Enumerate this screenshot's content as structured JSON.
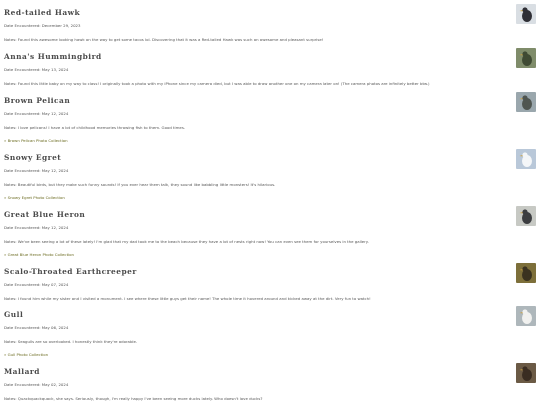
{
  "entries": [
    {
      "name": "Red-tailed Hawk",
      "date": "Date Encountered: December 29, 2023",
      "notes": "Notes: Found this awesome looking hawk on the way to get some tacos lol. Discovering that it was a Red-tailed Hawk was such an awesome and pleasant surprise!",
      "link": "",
      "thumb_icon": "hawk-photo",
      "thumb_colors": [
        "#d9dee3",
        "#2f2f35"
      ]
    },
    {
      "name": "Anna's Hummingbird",
      "date": "Date Encountered: May 13, 2024",
      "notes": "Notes: Found this little baby on my way to class! I originally took a photo with my iPhone since my camera died, but I was able to draw another one on my camera later on! (The camera photos are infinitely better btw.)",
      "link": "",
      "thumb_icon": "hummingbird-photo",
      "thumb_colors": [
        "#7f8c6a",
        "#3f4a33"
      ]
    },
    {
      "name": "Brown Pelican",
      "date": "Date Encountered: May 12, 2024",
      "notes": "Notes: I love pelicans! I have a lot of childhood memories throwing fish to them. Good times.",
      "link": "» Brown Pelican Photo Collection",
      "thumb_icon": "pelican-photo",
      "thumb_colors": [
        "#9aa7ad",
        "#4f5550"
      ]
    },
    {
      "name": "Snowy Egret",
      "date": "Date Encountered: May 12, 2024",
      "notes": "Notes: Beautiful birds, but they make such funny sounds! If you ever hear them talk, they sound like babbling little monsters! It's hilarious.",
      "link": "» Snowy Egret Photo Collection",
      "thumb_icon": "egret-photo",
      "thumb_colors": [
        "#b9c8d9",
        "#f4f6f8"
      ]
    },
    {
      "name": "Great Blue Heron",
      "date": "Date Encountered: May 12, 2024",
      "notes": "Notes: We've been seeing a lot of these lately! I'm glad that my dad took me to the beach because they have a lot of nests right now! You can even see them for yourselves in the gallery.",
      "link": "» Great Blue Heron Photo Collection",
      "thumb_icon": "heron-photo",
      "thumb_colors": [
        "#c7c9c4",
        "#3c3d40"
      ]
    },
    {
      "name": "Scalo-Throated Earthcreeper",
      "date": "Date Encountered: May 07, 2024",
      "notes": "Notes: I found him while my sister and I visited a monument. I see where these little guys get their name! The whole time it hovered around and kicked away at the dirt. Very fun to watch!",
      "link": "",
      "thumb_icon": "earthcreeper-photo",
      "thumb_colors": [
        "#7d6f3a",
        "#3a3220"
      ]
    },
    {
      "name": "Gull",
      "date": "Date Encountered: May 06, 2024",
      "notes": "Notes: Seagulls are so overlooked. I honestly think they're adorable.",
      "link": "» Gull Photo Collection",
      "thumb_icon": "gull-photo",
      "thumb_colors": [
        "#aeb7bb",
        "#f1f1ef"
      ]
    },
    {
      "name": "Mallard",
      "date": "Date Encountered: May 02, 2024",
      "notes": "Notes: Quackquackquack, she says. Seriously, though, I'm really happy I've been seeing more ducks lately. Who doesn't love ducks?",
      "link": "",
      "thumb_icon": "mallard-photo",
      "thumb_colors": [
        "#6b5a45",
        "#3a2d22"
      ]
    }
  ]
}
